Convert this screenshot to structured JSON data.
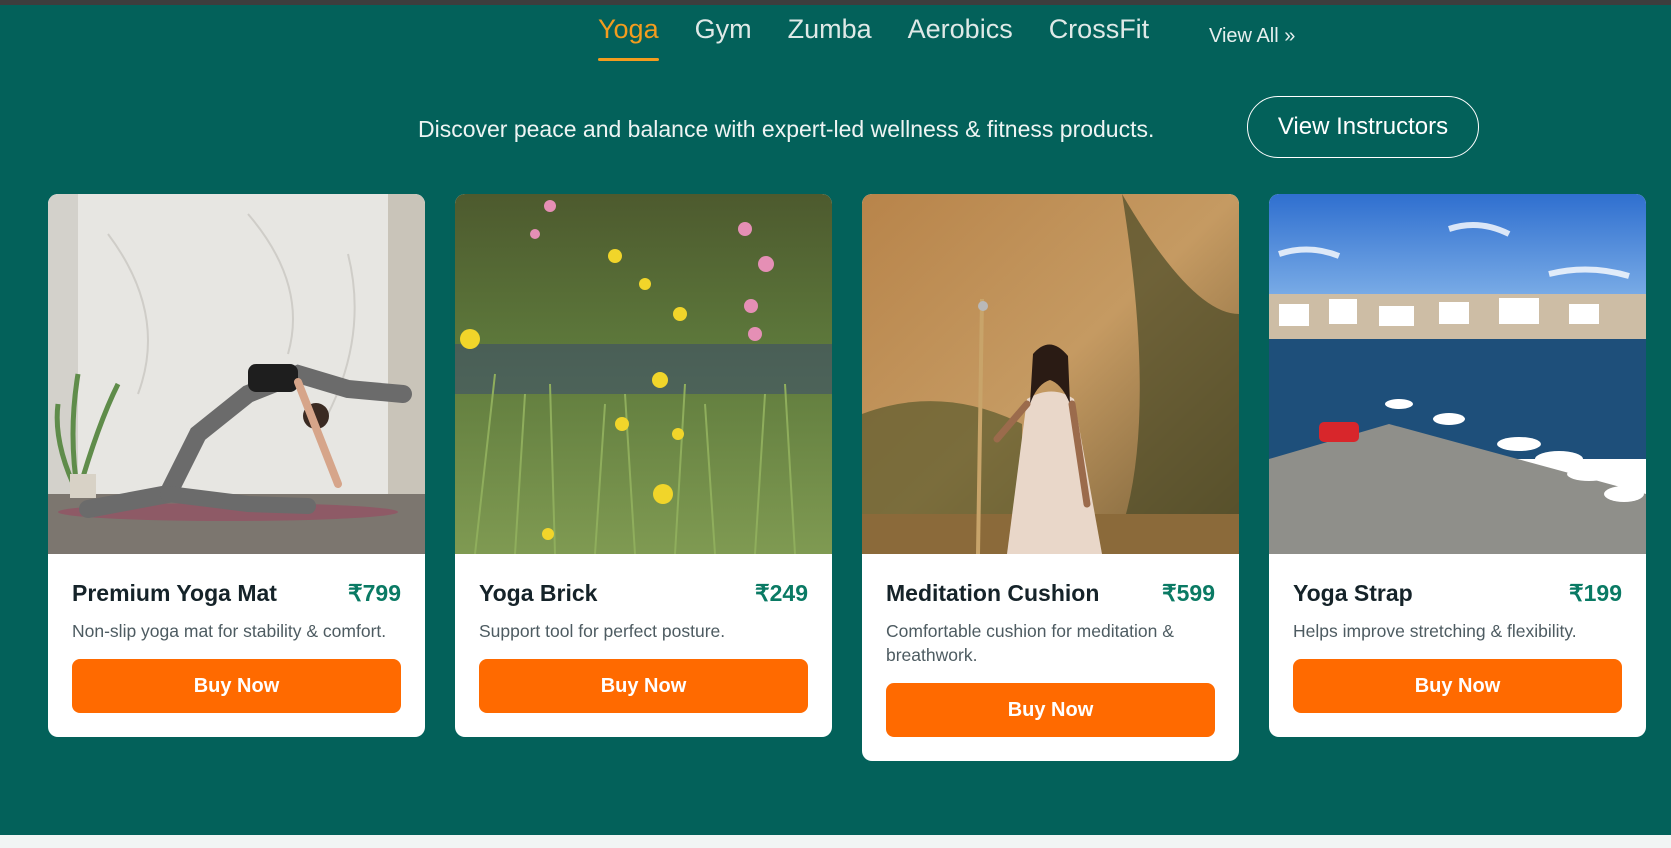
{
  "nav": {
    "tabs": [
      {
        "label": "Yoga"
      },
      {
        "label": "Gym"
      },
      {
        "label": "Zumba"
      },
      {
        "label": "Aerobics"
      },
      {
        "label": "CrossFit"
      }
    ],
    "active_tab": "Yoga",
    "view_all_label": "View All »"
  },
  "hero": {
    "tagline": "Discover peace and balance with expert-led wellness & fitness products.",
    "instructors_button": "View Instructors"
  },
  "products": [
    {
      "title": "Premium Yoga Mat",
      "price": "₹799",
      "description": "Non-slip yoga mat for stability & comfort.",
      "button": "Buy Now",
      "image": "yoga-pose-photo"
    },
    {
      "title": "Yoga Brick",
      "price": "₹249",
      "description": "Support tool for perfect posture.",
      "button": "Buy Now",
      "image": "wildflower-meadow-photo"
    },
    {
      "title": "Meditation Cushion",
      "price": "₹599",
      "description": "Comfortable cushion for meditation & breathwork.",
      "button": "Buy Now",
      "image": "woman-with-staff-photo"
    },
    {
      "title": "Yoga Strap",
      "price": "₹199",
      "description": "Helps improve stretching & flexibility.",
      "button": "Buy Now",
      "image": "harbor-boats-photo"
    }
  ],
  "colors": {
    "section_bg": "#03615a",
    "accent": "#f39c1e",
    "buy_button": "#ff6a00",
    "price": "#0a7a64"
  }
}
